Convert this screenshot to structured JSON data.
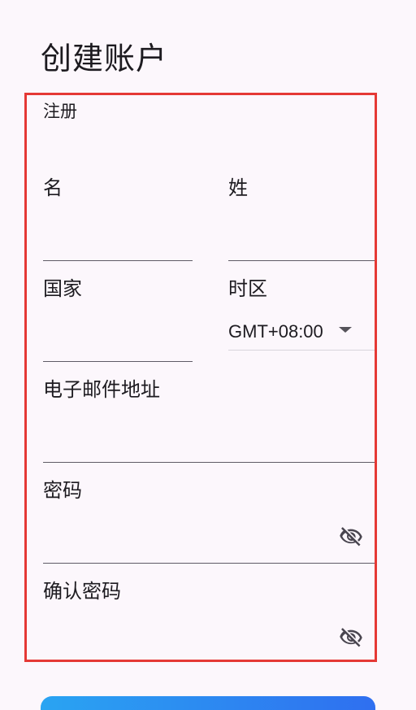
{
  "header": {
    "title": "创建账户"
  },
  "form": {
    "section_label": "注册",
    "first_name": {
      "label": "名",
      "value": ""
    },
    "last_name": {
      "label": "姓",
      "value": ""
    },
    "country": {
      "label": "国家",
      "value": ""
    },
    "timezone": {
      "label": "时区",
      "selected": "GMT+08:00"
    },
    "email": {
      "label": "电子邮件地址",
      "value": ""
    },
    "password": {
      "label": "密码",
      "value": "",
      "toggle_icon": "eye-off-icon"
    },
    "confirm_password": {
      "label": "确认密码",
      "value": "",
      "toggle_icon": "eye-off-icon"
    }
  },
  "colors": {
    "background": "#fcf7fc",
    "highlight_frame": "#e53935",
    "button_gradient_start": "#2aa4f2",
    "button_gradient_end": "#2f6ff0"
  }
}
